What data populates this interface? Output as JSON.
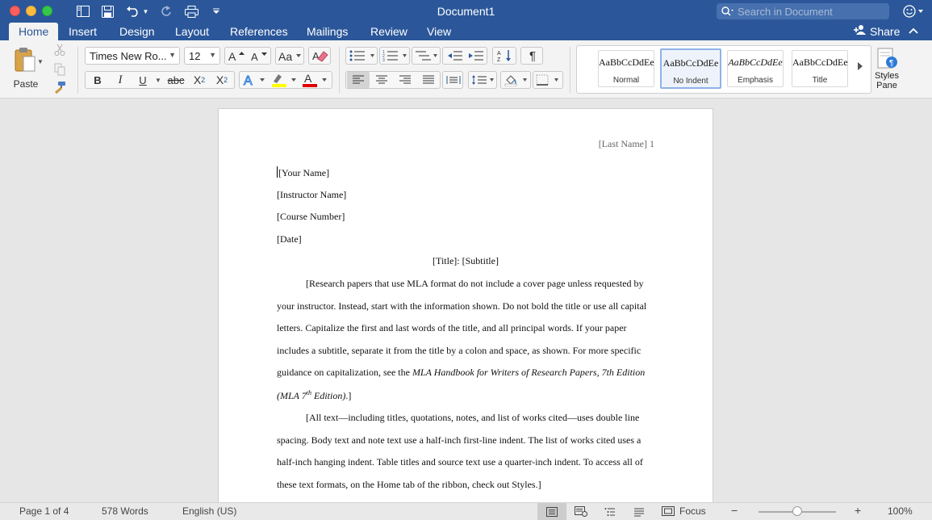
{
  "window": {
    "title": "Document1",
    "search_placeholder": "Search in Document"
  },
  "tabs": [
    {
      "label": "Home",
      "active": true
    },
    {
      "label": "Insert"
    },
    {
      "label": "Design"
    },
    {
      "label": "Layout"
    },
    {
      "label": "References"
    },
    {
      "label": "Mailings"
    },
    {
      "label": "Review"
    },
    {
      "label": "View"
    }
  ],
  "share_label": "Share",
  "ribbon": {
    "paste_label": "Paste",
    "font_name": "Times New Ro...",
    "font_size": "12",
    "bold": "B",
    "italic": "I",
    "underline": "U",
    "strike": "abc",
    "subscript": "X",
    "subscript_small": "2",
    "superscript": "X",
    "superscript_small": "2",
    "styles": [
      {
        "sample": "AaBbCcDdEe",
        "name": "Normal"
      },
      {
        "sample": "AaBbCcDdEe",
        "name": "No Indent",
        "selected": true
      },
      {
        "sample": "AaBbCcDdEe",
        "name": "Emphasis"
      },
      {
        "sample": "AaBbCcDdEe",
        "name": "Title"
      }
    ],
    "styles_pane_label_1": "Styles",
    "styles_pane_label_2": "Pane"
  },
  "document": {
    "running_head": "[Last Name] 1",
    "heading_lines": [
      "[Your Name]",
      "[Instructor Name]",
      "[Course Number]",
      "[Date]"
    ],
    "title": "[Title]: [Subtitle]",
    "p1_l1": "[Research papers that use MLA format do not include a cover page unless requested by",
    "p1_l2": "your instructor. Instead, start with the information shown. Do not bold the title or use all capital",
    "p1_l3": "letters. Capitalize the first and last words of the title, and all principal words. If your paper",
    "p1_l4": "includes a subtitle, separate it from the title by a colon and space, as shown. For more specific",
    "p1_l5_pre": "guidance on capitalization, see the ",
    "p1_l5_ital": "MLA Handbook for Writers of Research Papers, 7th Edition",
    "p1_l6_ital_a": "(MLA 7",
    "p1_l6_sup": "th",
    "p1_l6_ital_b": " Edition)",
    "p1_l6_post": ".]",
    "p2_l1": "[All text—including titles, quotations, notes, and list of works cited—uses double line",
    "p2_l2": "spacing. Body text and note text use a half-inch first-line indent. The list of works cited uses a",
    "p2_l3": "half-inch hanging indent. Table titles and source text use a quarter-inch indent. To access all of",
    "p2_l4": "these text formats, on the Home tab of the ribbon, check out Styles.]"
  },
  "status": {
    "page": "Page 1 of 4",
    "words": "578 Words",
    "language": "English (US)",
    "focus": "Focus",
    "zoom_minus": "−",
    "zoom_plus": "+",
    "zoom": "100%",
    "zoom_level": 100
  },
  "colors": {
    "brand": "#2b579a",
    "highlight": "#ffff00",
    "font_color": "#e00000"
  }
}
